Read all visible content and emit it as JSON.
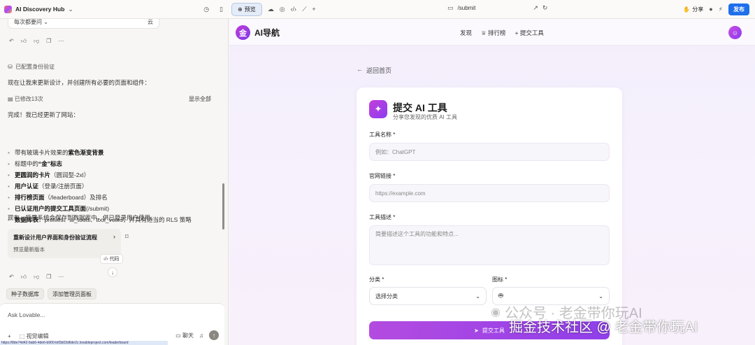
{
  "app": {
    "title": "AI Discovery Hub"
  },
  "toolbar": {
    "preview_label": "预览",
    "url": "/submit",
    "share_label": "分享",
    "publish_label": "发布"
  },
  "chat": {
    "ask_box_text": "每次都要问",
    "ask_box_suffix": "云",
    "auth_note": "已配置身份验证",
    "request_text": "现在让我来更新设计，并创建所有必要的页面和组件：",
    "edited_label": "已修改13次",
    "show_all_label": "显示全部",
    "done_text": "完成！我已经更新了网站：",
    "bullets": [
      {
        "pre": "带有玻璃卡片效果的",
        "bold": "紫色渐变背景",
        "post": ""
      },
      {
        "pre": "标题中的",
        "bold": "“金”标志",
        "post": ""
      },
      {
        "pre": "",
        "bold": "更圆润的卡片",
        "post": "（圆润型-2xl）"
      },
      {
        "pre": "",
        "bold": "用户认证",
        "post": "（登录/注册页面）"
      },
      {
        "pre": "",
        "bold": "排行榜页面",
        "post": "（/leaderboard）及排名"
      },
      {
        "pre": "",
        "bold": "已认证用户的提交工具页面",
        "post": "(/submit)"
      },
      {
        "pre": "",
        "bold": "数据库表",
        "post": "：profiles、ai_tools、tool_votes，并具有适当的 RLS 策略"
      }
    ],
    "closing_text": "现在，投票系统会保存到数据库中，供已登录用户使用。",
    "card_title": "重新设计用户界面和身份验证流程",
    "card_sub": "预览最新版本",
    "code_label": "代码",
    "chips": [
      "种子数据库",
      "添加管理员面板"
    ],
    "composer_placeholder": "Ask Lovable...",
    "visual_edit_label": "视觉编辑",
    "chat_label": "聊天",
    "status_url": "https://8de74d42-9ab6-4de6-b900-b65b03d6de2c.lovableproject.com/leaderboard"
  },
  "site": {
    "brand_badge": "金",
    "brand_name": "AI导航",
    "nav": [
      "发现",
      "排行榜",
      "+ 提交工具"
    ],
    "back_label": "返回首页",
    "form_title": "提交 AI 工具",
    "form_sub": "分享您发现的优质 AI 工具",
    "name_label": "工具名称 *",
    "name_placeholder": "例如：ChatGPT",
    "url_label": "官网链接 *",
    "url_placeholder": "https://example.com",
    "desc_label": "工具描述 *",
    "desc_placeholder": "简要描述这个工具的功能和特点...",
    "category_label": "分类 *",
    "category_value": "选择分类",
    "icon_label": "图标 *",
    "submit_label": "提交工具"
  },
  "watermark": {
    "line1": "公众号 · 老金带你玩AI",
    "line2": "掘金技术社区 @ 老金带你玩AI"
  }
}
